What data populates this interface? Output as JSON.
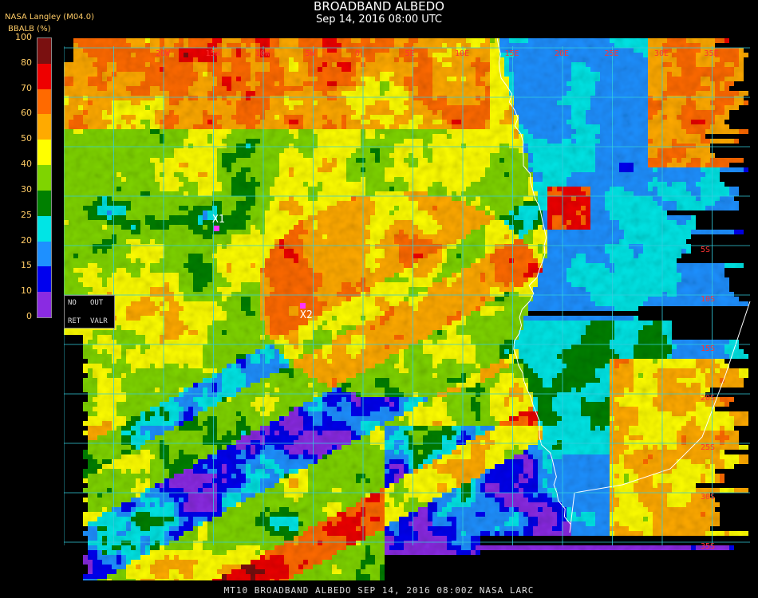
{
  "header": {
    "title": "BROADBAND ALBEDO",
    "subtitle": "Sep 14, 2016 08:00 UTC",
    "provider": "NASA Langley (M04.0)",
    "variable_label": "BBALB (%)"
  },
  "legend": {
    "ticks": [
      "100",
      "80",
      "70",
      "60",
      "50",
      "40",
      "30",
      "25",
      "20",
      "15",
      "10",
      "0"
    ],
    "bins": [
      {
        "from": 0,
        "to": 10,
        "color": "#8a2be2"
      },
      {
        "from": 10,
        "to": 15,
        "color": "#0000ee"
      },
      {
        "from": 15,
        "to": 20,
        "color": "#1e90ff"
      },
      {
        "from": 20,
        "to": 25,
        "color": "#00e5e5"
      },
      {
        "from": 25,
        "to": 30,
        "color": "#008000"
      },
      {
        "from": 30,
        "to": 40,
        "color": "#7fd400"
      },
      {
        "from": 40,
        "to": 50,
        "color": "#ffff00"
      },
      {
        "from": 50,
        "to": 60,
        "color": "#ffaa00"
      },
      {
        "from": 60,
        "to": 70,
        "color": "#ff6a00"
      },
      {
        "from": 70,
        "to": 80,
        "color": "#ee0000"
      },
      {
        "from": 80,
        "to": 100,
        "color": "#7a1010"
      }
    ]
  },
  "nodata_box": {
    "no": "NO",
    "out": "OUT",
    "ret": "RET",
    "valr": "VALR"
  },
  "markers": [
    {
      "label": "X1"
    },
    {
      "label": "X2"
    }
  ],
  "longitude_labels": [
    "20W",
    "15W",
    "10W",
    "5W",
    "0",
    "5E",
    "10E",
    "15E",
    "20E",
    "25E",
    "30E",
    "35E"
  ],
  "latitude_labels": [
    "5S",
    "10S",
    "15S",
    "20S",
    "25S",
    "30S",
    "35S"
  ],
  "footer": "MT10  BROADBAND ALBEDO   SEP 14, 2016 08:00Z   NASA LARC",
  "colors": {
    "grid": "#33ccdd",
    "coastline": "#ffffff",
    "label_red": "#ff3333",
    "legend_text": "#ffcc66"
  }
}
